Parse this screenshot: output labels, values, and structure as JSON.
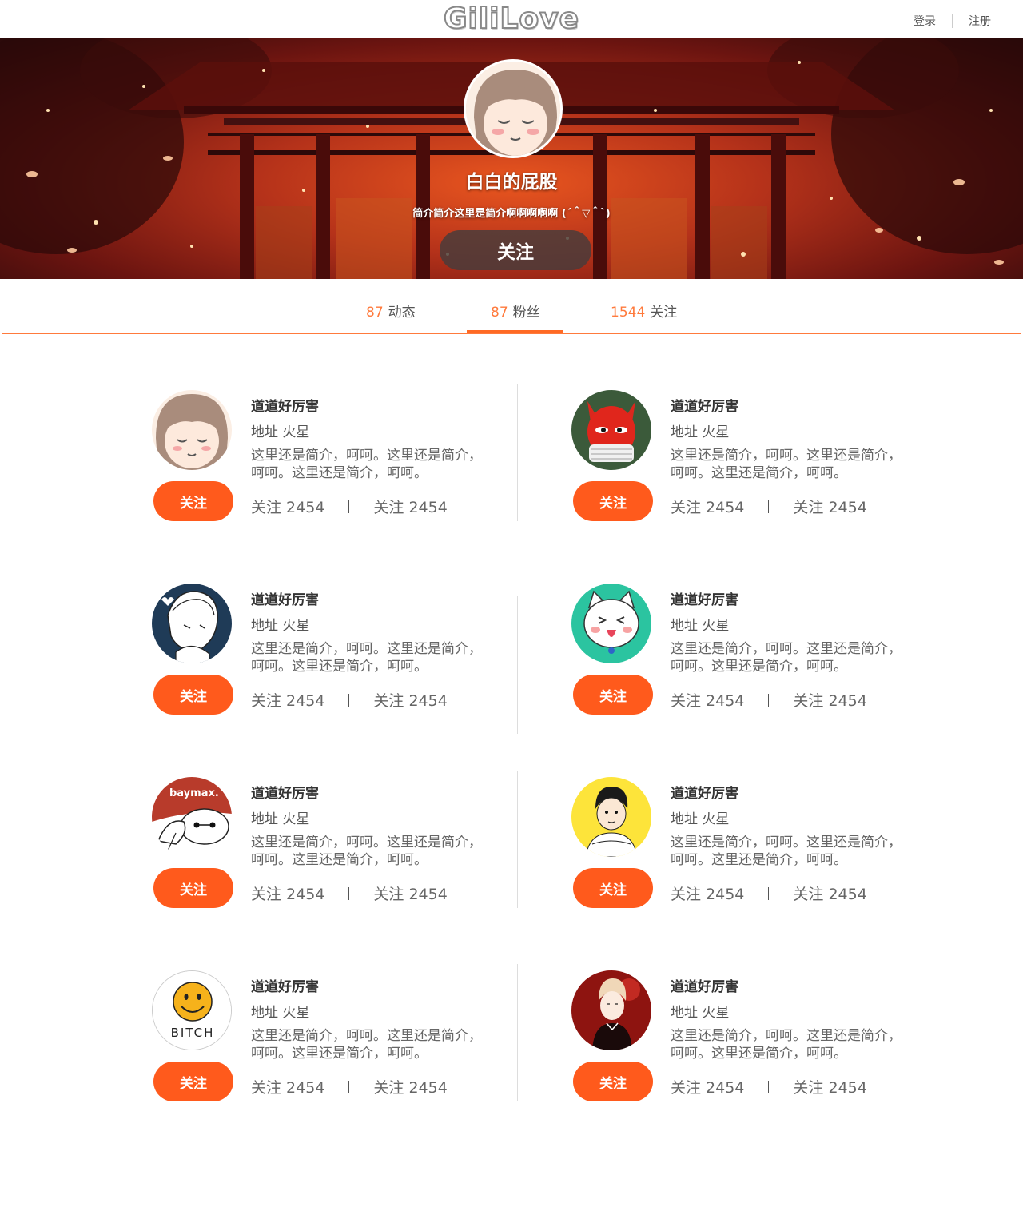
{
  "nav": {
    "logo": "GiliLove",
    "login": "登录",
    "register": "注册"
  },
  "profile": {
    "name": "白白的屁股",
    "bio": "简介简介这里是简介啊啊啊啊啊 (´＾▽＾`)",
    "follow_label": "关注"
  },
  "tabs": [
    {
      "count": "87",
      "label": "动态"
    },
    {
      "count": "87",
      "label": "粉丝"
    },
    {
      "count": "1544",
      "label": "关注"
    }
  ],
  "fans": [
    {
      "name": "道道好厉害",
      "address": "地址 火星",
      "bio": "这里还是简介，呵呵。这里还是简介，呵呵。这里还是简介，呵呵。",
      "follow_label": "关注",
      "stat1": "关注 2454",
      "stat2": "关注 2454",
      "avatar": "girl-avatar-icon"
    },
    {
      "name": "道道好厉害",
      "address": "地址 火星",
      "bio": "这里还是简介，呵呵。这里还是简介，呵呵。这里还是简介，呵呵。",
      "follow_label": "关注",
      "stat1": "关注 2454",
      "stat2": "关注 2454",
      "avatar": "red-devil-avatar-icon"
    },
    {
      "name": "道道好厉害",
      "address": "地址 火星",
      "bio": "这里还是简介，呵呵。这里还是简介，呵呵。这里还是简介，呵呵。",
      "follow_label": "关注",
      "stat1": "关注 2454",
      "stat2": "关注 2454",
      "avatar": "sketch-boy-avatar-icon"
    },
    {
      "name": "道道好厉害",
      "address": "地址 火星",
      "bio": "这里还是简介，呵呵。这里还是简介，呵呵。这里还是简介，呵呵。",
      "follow_label": "关注",
      "stat1": "关注 2454",
      "stat2": "关注 2454",
      "avatar": "white-cat-avatar-icon"
    },
    {
      "name": "道道好厉害",
      "address": "地址 火星",
      "bio": "这里还是简介，呵呵。这里还是简介，呵呵。这里还是简介，呵呵。",
      "follow_label": "关注",
      "stat1": "关注 2454",
      "stat2": "关注 2454",
      "avatar": "baymax-avatar-icon",
      "avatar_text": "baymax."
    },
    {
      "name": "道道好厉害",
      "address": "地址 火星",
      "bio": "这里还是简介，呵呵。这里还是简介，呵呵。这里还是简介，呵呵。",
      "follow_label": "关注",
      "stat1": "关注 2454",
      "stat2": "关注 2454",
      "avatar": "yellow-boy-avatar-icon"
    },
    {
      "name": "道道好厉害",
      "address": "地址 火星",
      "bio": "这里还是简介，呵呵。这里还是简介，呵呵。这里还是简介，呵呵。",
      "follow_label": "关注",
      "stat1": "关注 2454",
      "stat2": "关注 2454",
      "avatar": "smiley-avatar-icon",
      "avatar_text": "BITCH"
    },
    {
      "name": "道道好厉害",
      "address": "地址 火星",
      "bio": "这里还是简介，呵呵。这里还是简介，呵呵。这里还是简介，呵呵。",
      "follow_label": "关注",
      "stat1": "关注 2454",
      "stat2": "关注 2454",
      "avatar": "red-prince-avatar-icon"
    }
  ],
  "colors": {
    "accent": "#ff5a1c",
    "tab_count": "#ff7a3c"
  }
}
